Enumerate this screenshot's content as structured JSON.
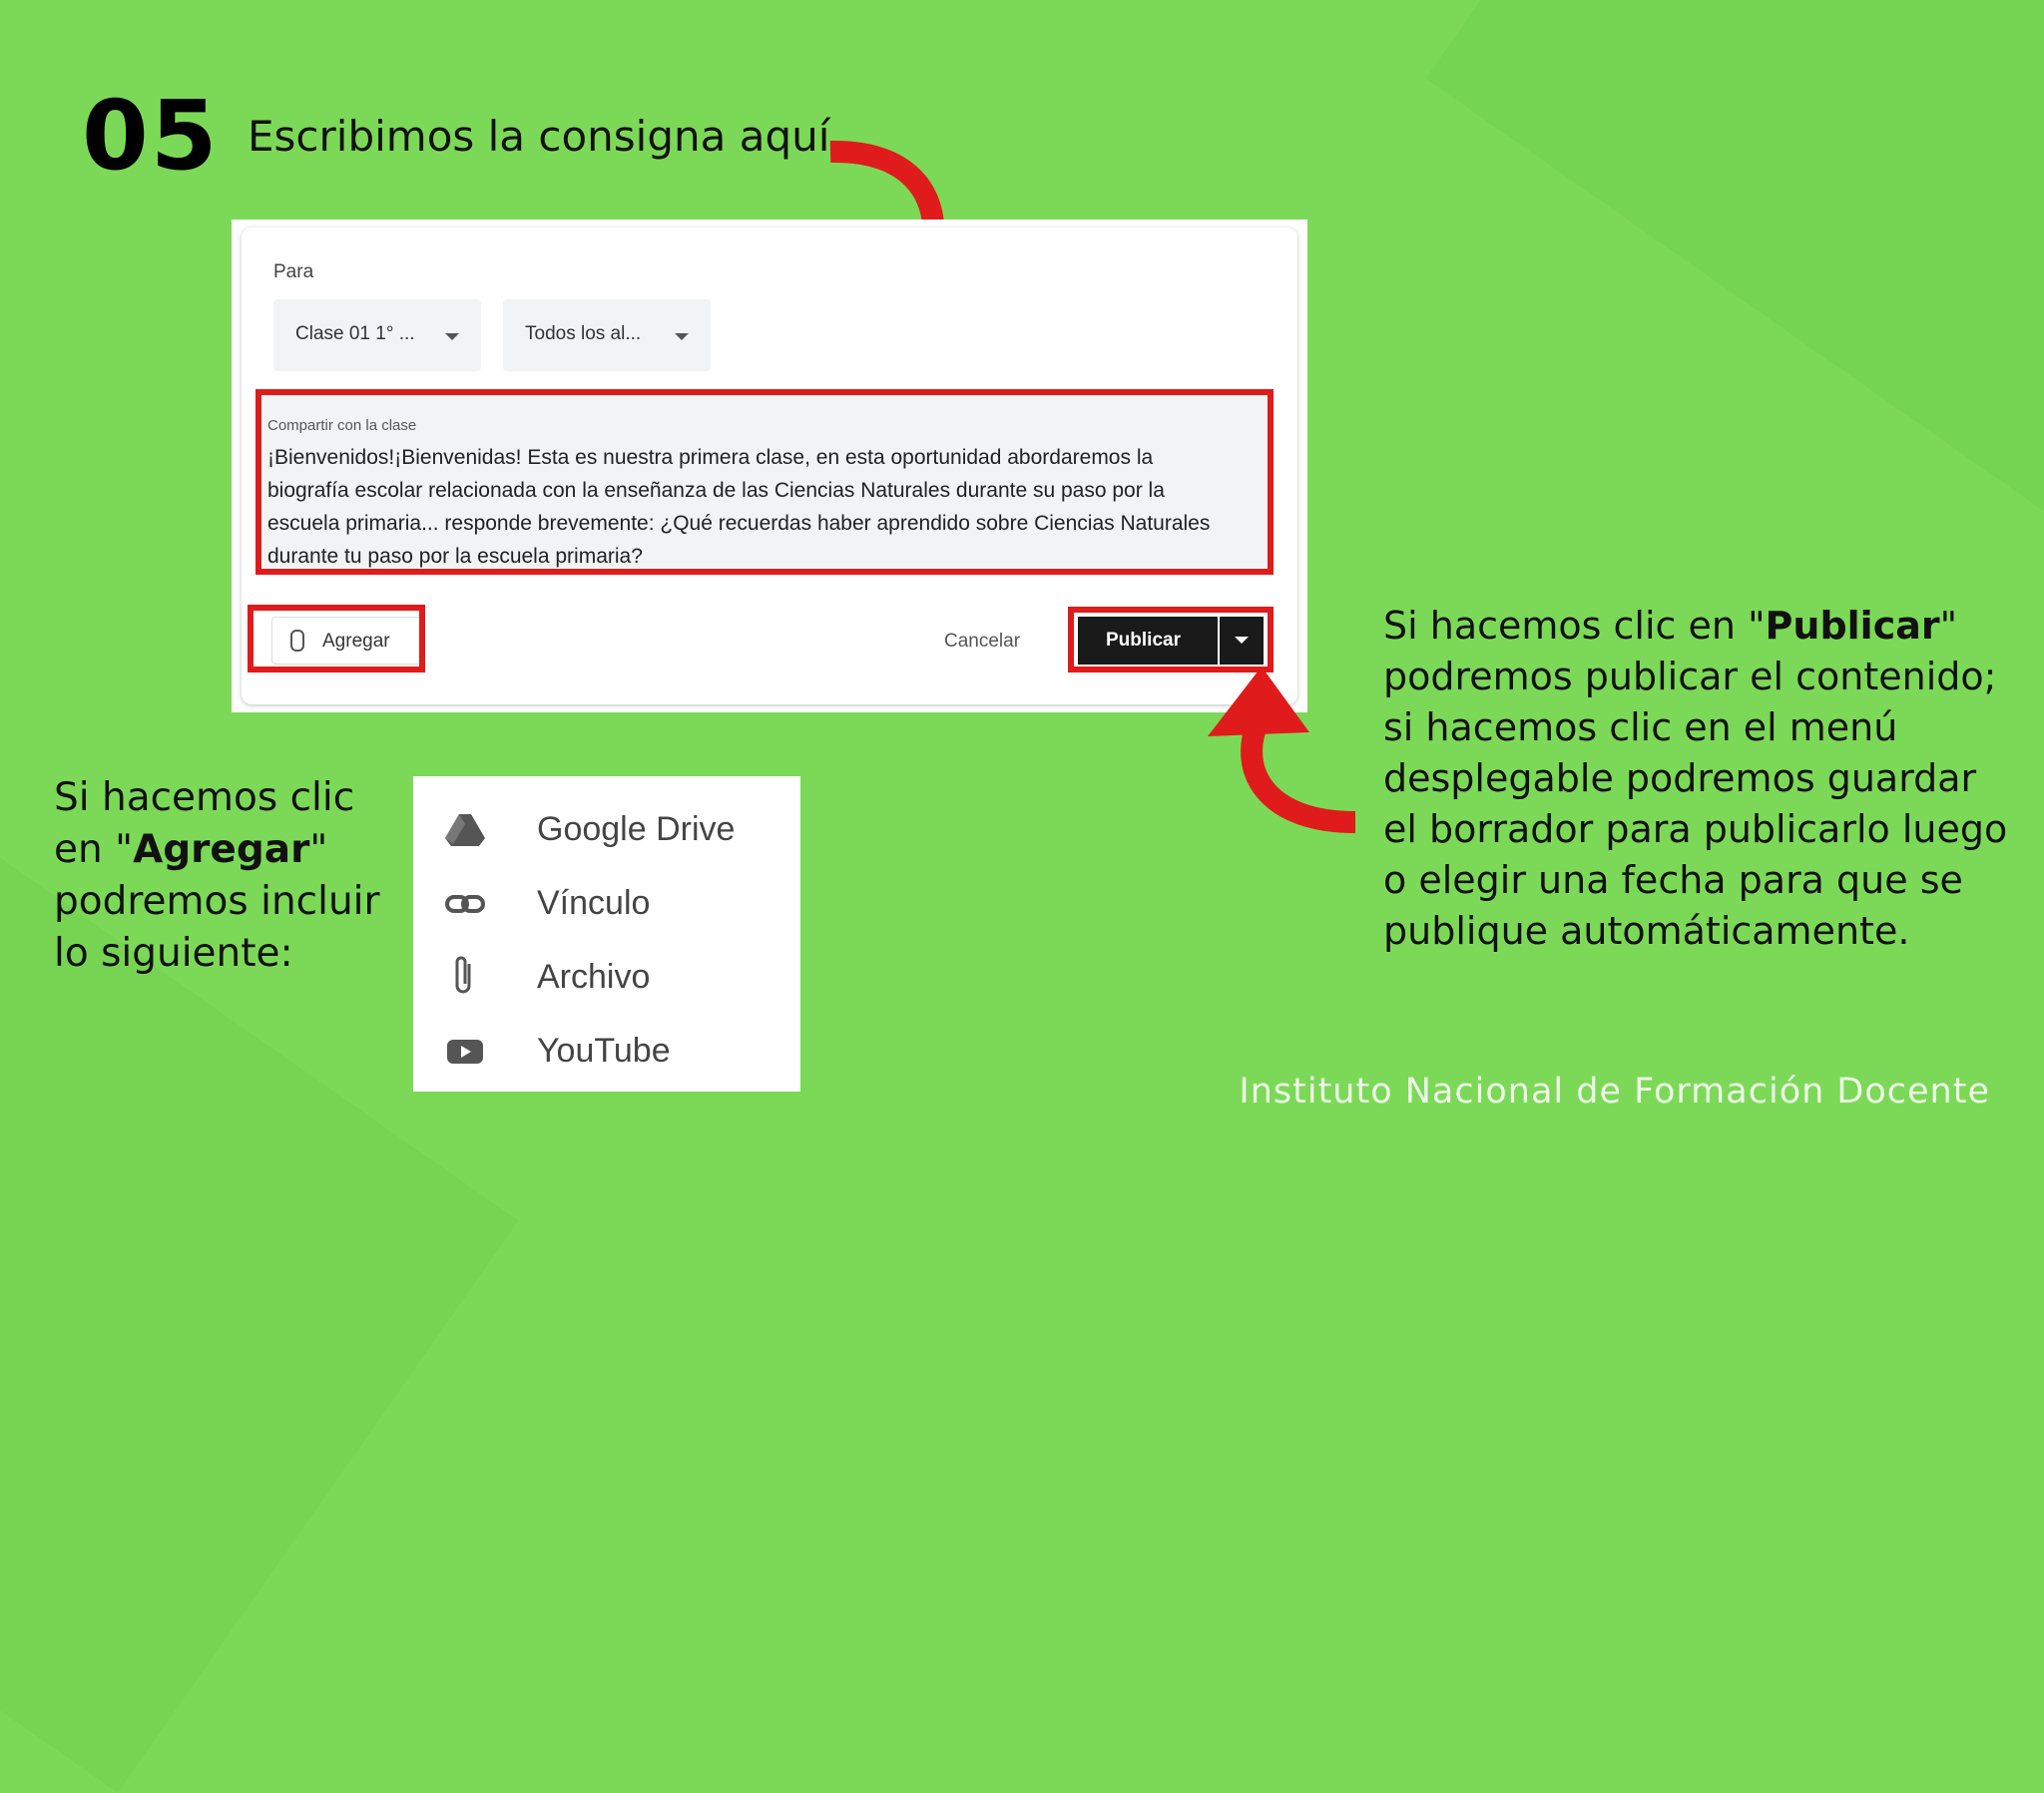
{
  "step_number": "05",
  "headline": "Escribimos la consigna aquí...",
  "form": {
    "para_label": "Para",
    "class_select": "Clase 01 1° ...",
    "students_select": "Todos los al...",
    "share_label": "Compartir con la clase",
    "share_text": "¡Bienvenidos!¡Bienvenidas! Esta es nuestra primera clase, en esta oportunidad abordaremos la biografía escolar relacionada con la enseñanza de las Ciencias Naturales durante su paso por la escuela primaria... responde brevemente: ¿Qué recuerdas haber aprendido sobre Ciencias Naturales durante tu  paso por la escuela primaria?",
    "add_label": "Agregar",
    "cancel_label": "Cancelar",
    "publish_label": "Publicar"
  },
  "left_caption": {
    "before": "Si hacemos clic en \"",
    "bold": "Agregar",
    "after": "\" podremos incluir lo siguiente:"
  },
  "menu": {
    "items": [
      {
        "label": "Google Drive",
        "icon": "google-drive-icon"
      },
      {
        "label": "Vínculo",
        "icon": "link-icon"
      },
      {
        "label": "Archivo",
        "icon": "paperclip-icon"
      },
      {
        "label": "YouTube",
        "icon": "youtube-icon"
      }
    ]
  },
  "right_caption": {
    "before": "Si hacemos clic en \"",
    "bold": "Publicar",
    "after": "\" podremos publicar el contenido; si hacemos clic en el menú desplegable podremos guardar el borrador para publicarlo luego o elegir una fecha para que se publique automáticamente."
  },
  "footer": "Instituto Nacional de Formación Docente",
  "colors": {
    "background": "#7cd957",
    "highlight": "#e01b1b",
    "publish": "#1a1a1a"
  }
}
